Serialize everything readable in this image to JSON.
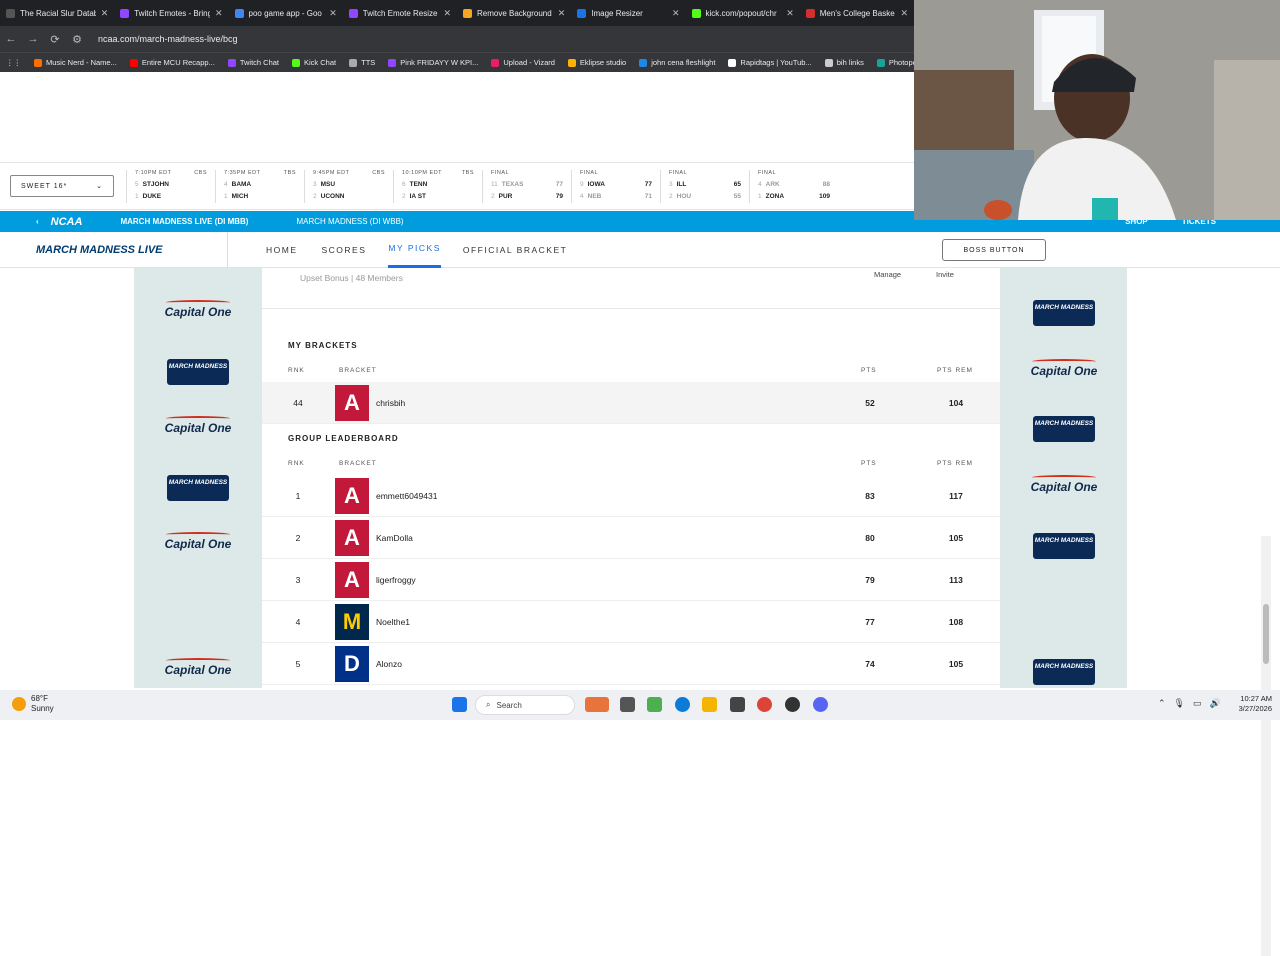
{
  "browser": {
    "tabs": [
      {
        "title": "The Racial Slur Databa",
        "color": "#555555"
      },
      {
        "title": "Twitch Emotes - Bring",
        "color": "#9146ff"
      },
      {
        "title": "poo game app - Goo",
        "color": "#4285f4"
      },
      {
        "title": "Twitch Emote Resizer",
        "color": "#9146ff"
      },
      {
        "title": "Remove Background",
        "color": "#f5a623"
      },
      {
        "title": "Image Resizer",
        "color": "#1a73e8"
      },
      {
        "title": "kick.com/popout/chr",
        "color": "#53fc18"
      },
      {
        "title": "Men's College Baske",
        "color": "#d32f2f"
      }
    ],
    "url": "ncaa.com/march-madness-live/bcg",
    "bookmarks": [
      {
        "label": "Music Nerd - Name...",
        "color": "#ff6f00"
      },
      {
        "label": "Entire MCU Recapp...",
        "color": "#ff0000"
      },
      {
        "label": "Twitch Chat",
        "color": "#9146ff"
      },
      {
        "label": "Kick Chat",
        "color": "#53fc18"
      },
      {
        "label": "TTS",
        "color": "#aaaaaa"
      },
      {
        "label": "Pink FRIDAYY W KPI...",
        "color": "#9146ff"
      },
      {
        "label": "Upload - Vizard",
        "color": "#e91e63"
      },
      {
        "label": "Eklipse studio",
        "color": "#ffb300"
      },
      {
        "label": "john cena fleshlight",
        "color": "#1e88e5"
      },
      {
        "label": "Rapidtags | YouTub...",
        "color": "#ffffff"
      },
      {
        "label": "bih links",
        "color": "#cccccc"
      },
      {
        "label": "Photopea",
        "color": "#18a497"
      }
    ]
  },
  "scoreboard": {
    "round": "SWEET 16*",
    "games": [
      {
        "status": "7:10PM EDT",
        "net": "CBS",
        "teams": [
          {
            "seed": "5",
            "name": "STJOHN",
            "score": ""
          },
          {
            "seed": "1",
            "name": "DUKE",
            "score": ""
          }
        ]
      },
      {
        "status": "7:35PM EDT",
        "net": "TBS",
        "teams": [
          {
            "seed": "4",
            "name": "BAMA",
            "score": ""
          },
          {
            "seed": "1",
            "name": "MICH",
            "score": ""
          }
        ]
      },
      {
        "status": "9:45PM EDT",
        "net": "CBS",
        "teams": [
          {
            "seed": "3",
            "name": "MSU",
            "score": ""
          },
          {
            "seed": "2",
            "name": "UCONN",
            "score": ""
          }
        ]
      },
      {
        "status": "10:10PM EDT",
        "net": "TBS",
        "teams": [
          {
            "seed": "6",
            "name": "TENN",
            "score": ""
          },
          {
            "seed": "2",
            "name": "IA ST",
            "score": ""
          }
        ]
      },
      {
        "status": "FINAL",
        "net": "",
        "teams": [
          {
            "seed": "11",
            "name": "TEXAS",
            "score": "77",
            "lose": true
          },
          {
            "seed": "2",
            "name": "PUR",
            "score": "79"
          }
        ]
      },
      {
        "status": "FINAL",
        "net": "",
        "teams": [
          {
            "seed": "9",
            "name": "IOWA",
            "score": "77"
          },
          {
            "seed": "4",
            "name": "NEB",
            "score": "71",
            "lose": true
          }
        ]
      },
      {
        "status": "FINAL",
        "net": "",
        "teams": [
          {
            "seed": "3",
            "name": "ILL",
            "score": "65"
          },
          {
            "seed": "2",
            "name": "HOU",
            "score": "55",
            "lose": true
          }
        ]
      },
      {
        "status": "FINAL",
        "net": "",
        "teams": [
          {
            "seed": "4",
            "name": "ARK",
            "score": "88",
            "lose": true
          },
          {
            "seed": "1",
            "name": "ZONA",
            "score": "109"
          }
        ]
      }
    ]
  },
  "ncaa_bar": {
    "logo": "NCAA",
    "link1": "MARCH MADNESS LIVE (DI MBB)",
    "link2": "MARCH MADNESS (DI WBB)",
    "shop": "SHOP",
    "tickets": "TICKETS"
  },
  "mm_nav": {
    "logo": "MARCH MADNESS LIVE",
    "items": [
      "HOME",
      "SCORES",
      "MY PICKS",
      "OFFICIAL BRACKET"
    ],
    "boss": "BOSS BUTTON"
  },
  "group": {
    "meta": "Upset Bonus | 48 Members",
    "manage": "Manage",
    "invite": "Invite"
  },
  "my_brackets": {
    "title": "MY BRACKETS",
    "headers": {
      "rank": "RNK",
      "bracket": "BRACKET",
      "pts": "PTS",
      "pts_rem": "PTS REM"
    },
    "rows": [
      {
        "rank": "44",
        "name": "chrisbih",
        "pts": "52",
        "pts_rem": "104",
        "logo": "A"
      }
    ]
  },
  "leaderboard": {
    "title": "GROUP LEADERBOARD",
    "headers": {
      "rank": "RNK",
      "bracket": "BRACKET",
      "pts": "PTS",
      "pts_rem": "PTS REM"
    },
    "rows": [
      {
        "rank": "1",
        "name": "emmett6049431",
        "pts": "83",
        "pts_rem": "117",
        "logo": "A"
      },
      {
        "rank": "2",
        "name": "KamDolla",
        "pts": "80",
        "pts_rem": "105",
        "logo": "A"
      },
      {
        "rank": "3",
        "name": "ligerfroggy",
        "pts": "79",
        "pts_rem": "113",
        "logo": "A"
      },
      {
        "rank": "4",
        "name": "Noelthe1",
        "pts": "77",
        "pts_rem": "108",
        "logo": "M"
      },
      {
        "rank": "5",
        "name": "Alonzo",
        "pts": "74",
        "pts_rem": "105",
        "logo": "D"
      }
    ]
  },
  "ads": {
    "capital_one": "Capital One",
    "march_madness": "MARCH MADNESS"
  },
  "taskbar": {
    "temp": "68°F",
    "weather": "Sunny",
    "search": "Search",
    "time": "10:27 AM",
    "date": "3/27/2026"
  }
}
